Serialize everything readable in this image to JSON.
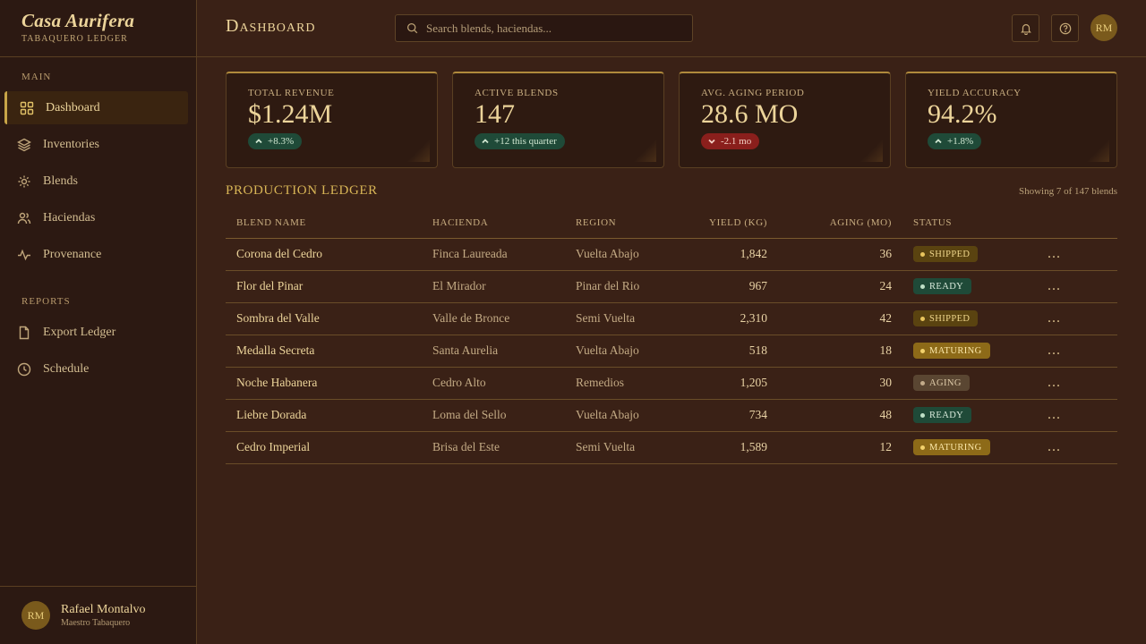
{
  "brand": {
    "title": "Casa Aurifera",
    "subtitle": "Tabaquero Ledger"
  },
  "sidebar": {
    "main_label": "Main",
    "reports_label": "Reports",
    "items": [
      {
        "label": "Dashboard",
        "icon": "grid-icon"
      },
      {
        "label": "Inventories",
        "icon": "layers-icon"
      },
      {
        "label": "Blends",
        "icon": "sun-icon"
      },
      {
        "label": "Haciendas",
        "icon": "users-icon"
      },
      {
        "label": "Provenance",
        "icon": "activity-icon"
      }
    ],
    "reports": [
      {
        "label": "Export Ledger",
        "icon": "file-icon"
      },
      {
        "label": "Schedule",
        "icon": "clock-icon"
      }
    ],
    "user": {
      "initials": "RM",
      "name": "Rafael Montalvo",
      "role": "Maestro Tabaquero"
    }
  },
  "header": {
    "title": "Dashboard",
    "search_placeholder": "Search blends, haciendas...",
    "avatar_initials": "RM"
  },
  "kpis": [
    {
      "label": "Total Revenue",
      "value": "$1.24M",
      "badge": "+8.3%",
      "trend": "up"
    },
    {
      "label": "Active Blends",
      "value": "147",
      "badge": "+12 this quarter",
      "trend": "up"
    },
    {
      "label": "Avg. Aging Period",
      "value": "28.6 MO",
      "badge": "-2.1 mo",
      "trend": "down"
    },
    {
      "label": "Yield Accuracy",
      "value": "94.2%",
      "badge": "+1.8%",
      "trend": "up"
    }
  ],
  "ledger": {
    "title": "Production Ledger",
    "count_text": "Showing 7 of 147 blends",
    "columns": [
      "Blend Name",
      "Hacienda",
      "Region",
      "Yield (kg)",
      "Aging (mo)",
      "Status"
    ],
    "rows": [
      {
        "name": "Corona del Cedro",
        "hacienda": "Finca Laureada",
        "region": "Vuelta Abajo",
        "yield": "1,842",
        "aging": "36",
        "status": "Shipped"
      },
      {
        "name": "Flor del Pinar",
        "hacienda": "El Mirador",
        "region": "Pinar del Rio",
        "yield": "967",
        "aging": "24",
        "status": "Ready"
      },
      {
        "name": "Sombra del Valle",
        "hacienda": "Valle de Bronce",
        "region": "Semi Vuelta",
        "yield": "2,310",
        "aging": "42",
        "status": "Shipped"
      },
      {
        "name": "Medalla Secreta",
        "hacienda": "Santa Aurelia",
        "region": "Vuelta Abajo",
        "yield": "518",
        "aging": "18",
        "status": "Maturing"
      },
      {
        "name": "Noche Habanera",
        "hacienda": "Cedro Alto",
        "region": "Remedios",
        "yield": "1,205",
        "aging": "30",
        "status": "Aging"
      },
      {
        "name": "Liebre Dorada",
        "hacienda": "Loma del Sello",
        "region": "Vuelta Abajo",
        "yield": "734",
        "aging": "48",
        "status": "Ready"
      },
      {
        "name": "Cedro Imperial",
        "hacienda": "Brisa del Este",
        "region": "Semi Vuelta",
        "yield": "1,589",
        "aging": "12",
        "status": "Maturing"
      }
    ],
    "row_menu": "..."
  }
}
